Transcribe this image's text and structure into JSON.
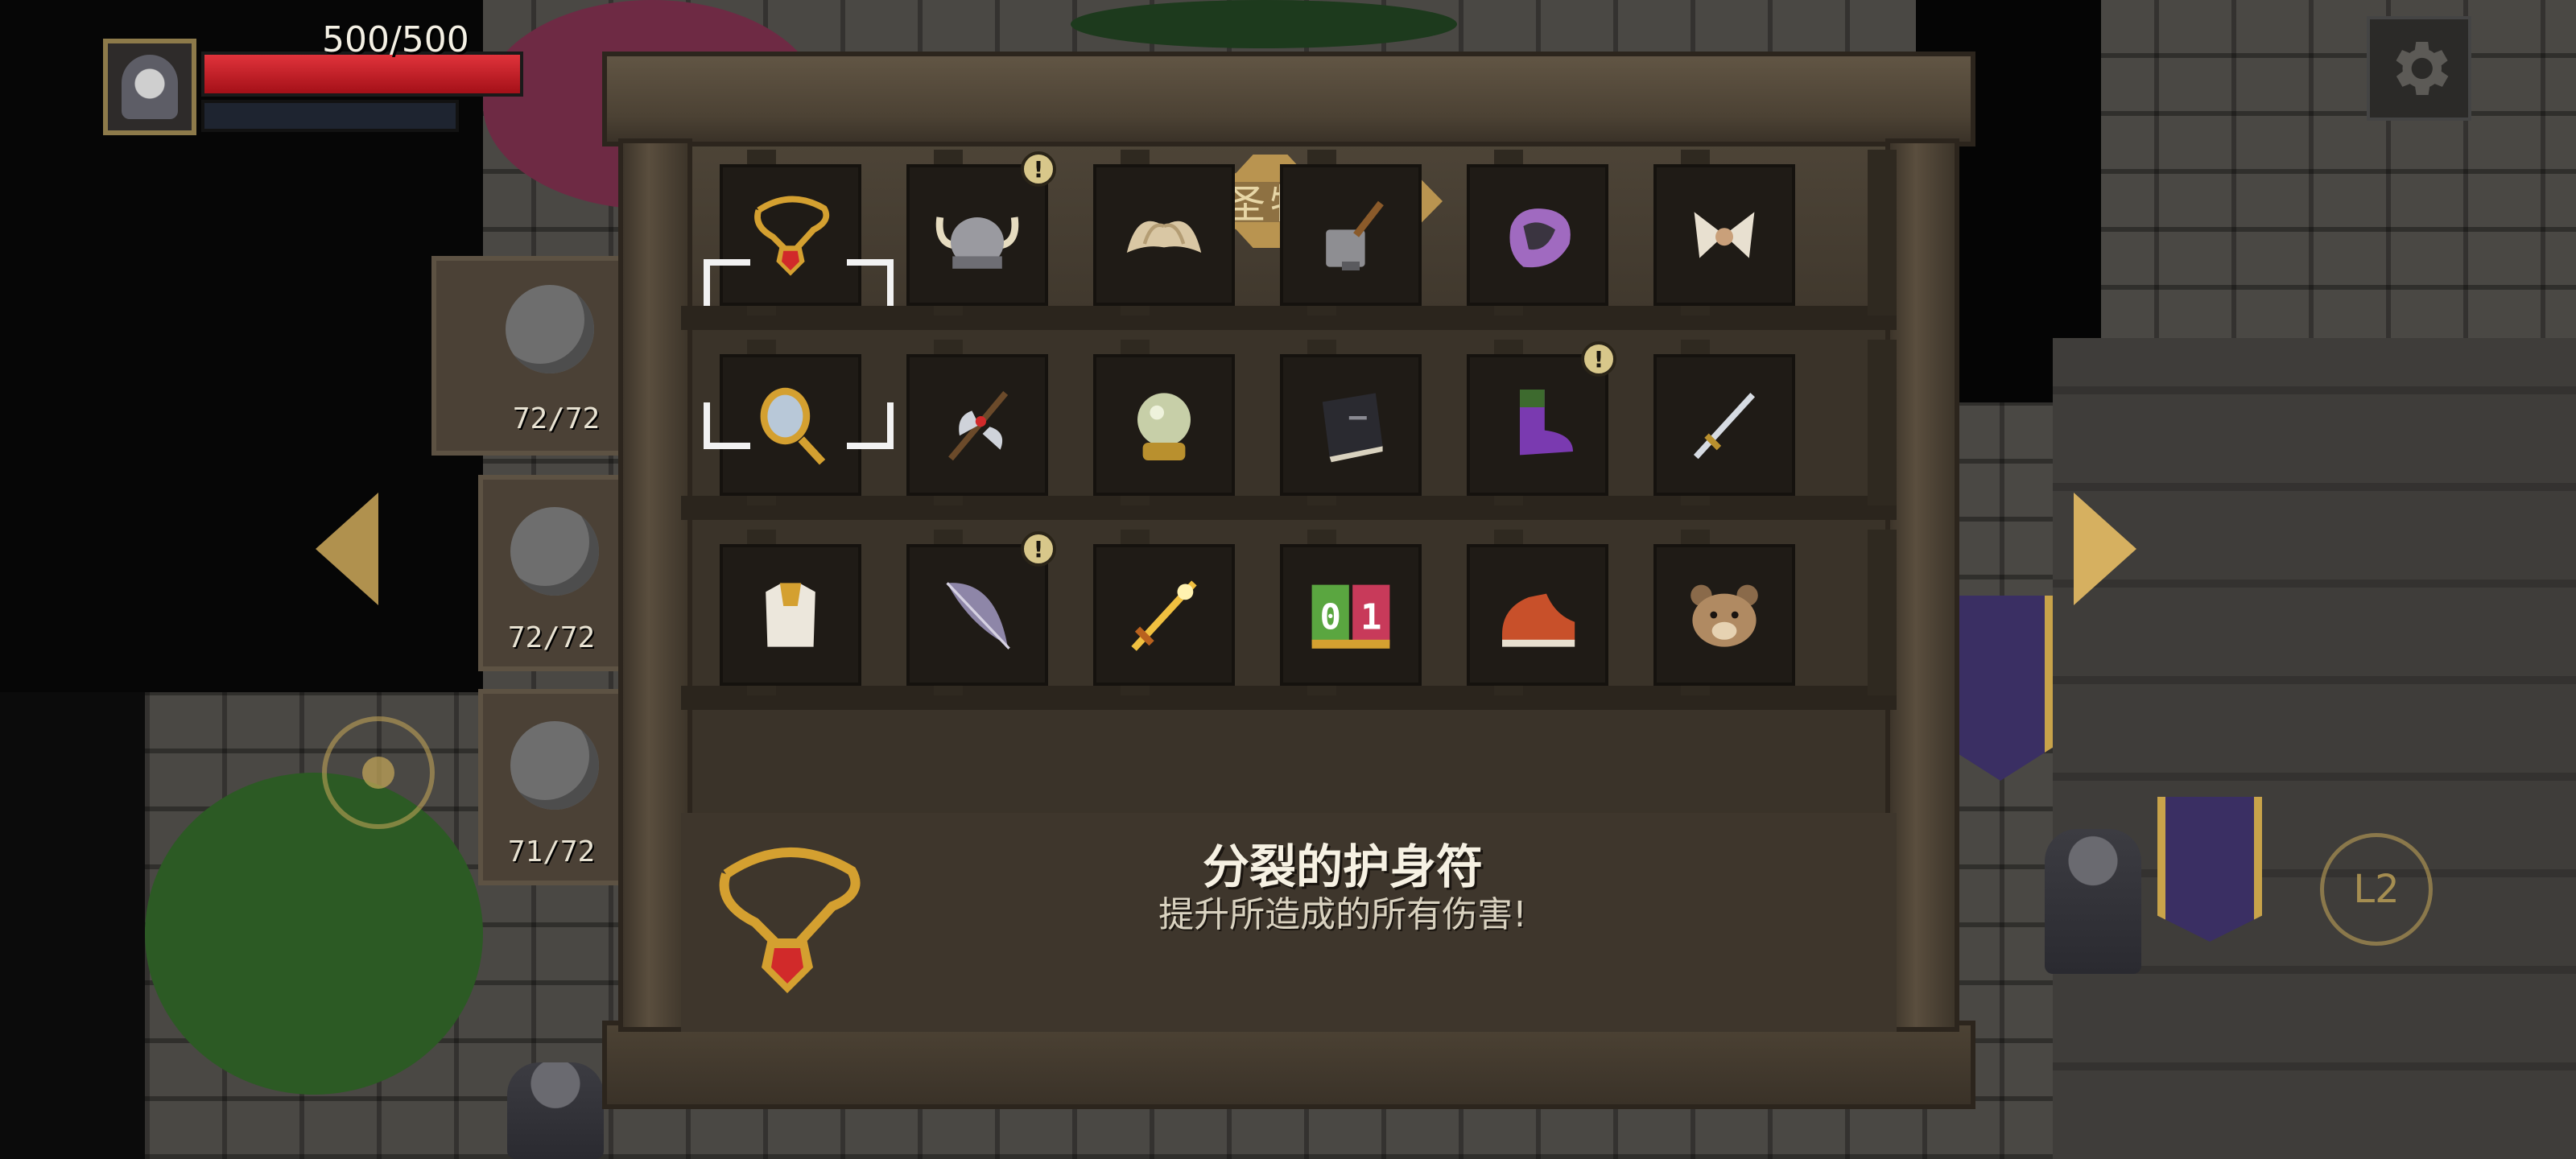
{
  "hud": {
    "hp_text": "500/500",
    "hp_fraction": 1.0,
    "settings_icon": "gear-icon"
  },
  "side_slots": [
    {
      "icon": "sword-icon",
      "count": "72/72"
    },
    {
      "icon": "shield-icon",
      "count": "72/72"
    },
    {
      "icon": "orb-icon",
      "count": "71/72"
    }
  ],
  "controls": {
    "l2_label": "L2"
  },
  "cabinet": {
    "title": "圣物",
    "rows": [
      [
        {
          "icon": "amulet-icon",
          "selected": true,
          "new": false
        },
        {
          "icon": "horned-helmet-icon",
          "selected": false,
          "new": true
        },
        {
          "icon": "wings-icon",
          "selected": false,
          "new": false
        },
        {
          "icon": "hammer-icon",
          "selected": false,
          "new": false
        },
        {
          "icon": "gauntlet-icon",
          "selected": false,
          "new": false
        },
        {
          "icon": "bow-tie-icon",
          "selected": false,
          "new": false
        }
      ],
      [
        {
          "icon": "mirror-icon",
          "selected": false,
          "new": false
        },
        {
          "icon": "battle-axe-icon",
          "selected": false,
          "new": false
        },
        {
          "icon": "crystal-ball-icon",
          "selected": false,
          "new": false
        },
        {
          "icon": "book-icon",
          "selected": false,
          "new": false
        },
        {
          "icon": "boot-icon",
          "selected": false,
          "new": true
        },
        {
          "icon": "dagger-icon",
          "selected": false,
          "new": false
        }
      ],
      [
        {
          "icon": "armor-icon",
          "selected": false,
          "new": false
        },
        {
          "icon": "feather-icon",
          "selected": false,
          "new": true
        },
        {
          "icon": "flame-sword-icon",
          "selected": false,
          "new": false
        },
        {
          "icon": "calendar-icon",
          "selected": false,
          "new": false,
          "digits": [
            "0",
            "1"
          ]
        },
        {
          "icon": "sneaker-icon",
          "selected": false,
          "new": false
        },
        {
          "icon": "bear-face-icon",
          "selected": false,
          "new": false
        }
      ]
    ],
    "badge_symbol": "!",
    "selected_item": {
      "name": "分裂的护身符",
      "description": "提升所造成的所有伤害!"
    }
  },
  "colors": {
    "hp": "#d42a32",
    "gold": "#b99450",
    "wood": "#4c4234"
  }
}
